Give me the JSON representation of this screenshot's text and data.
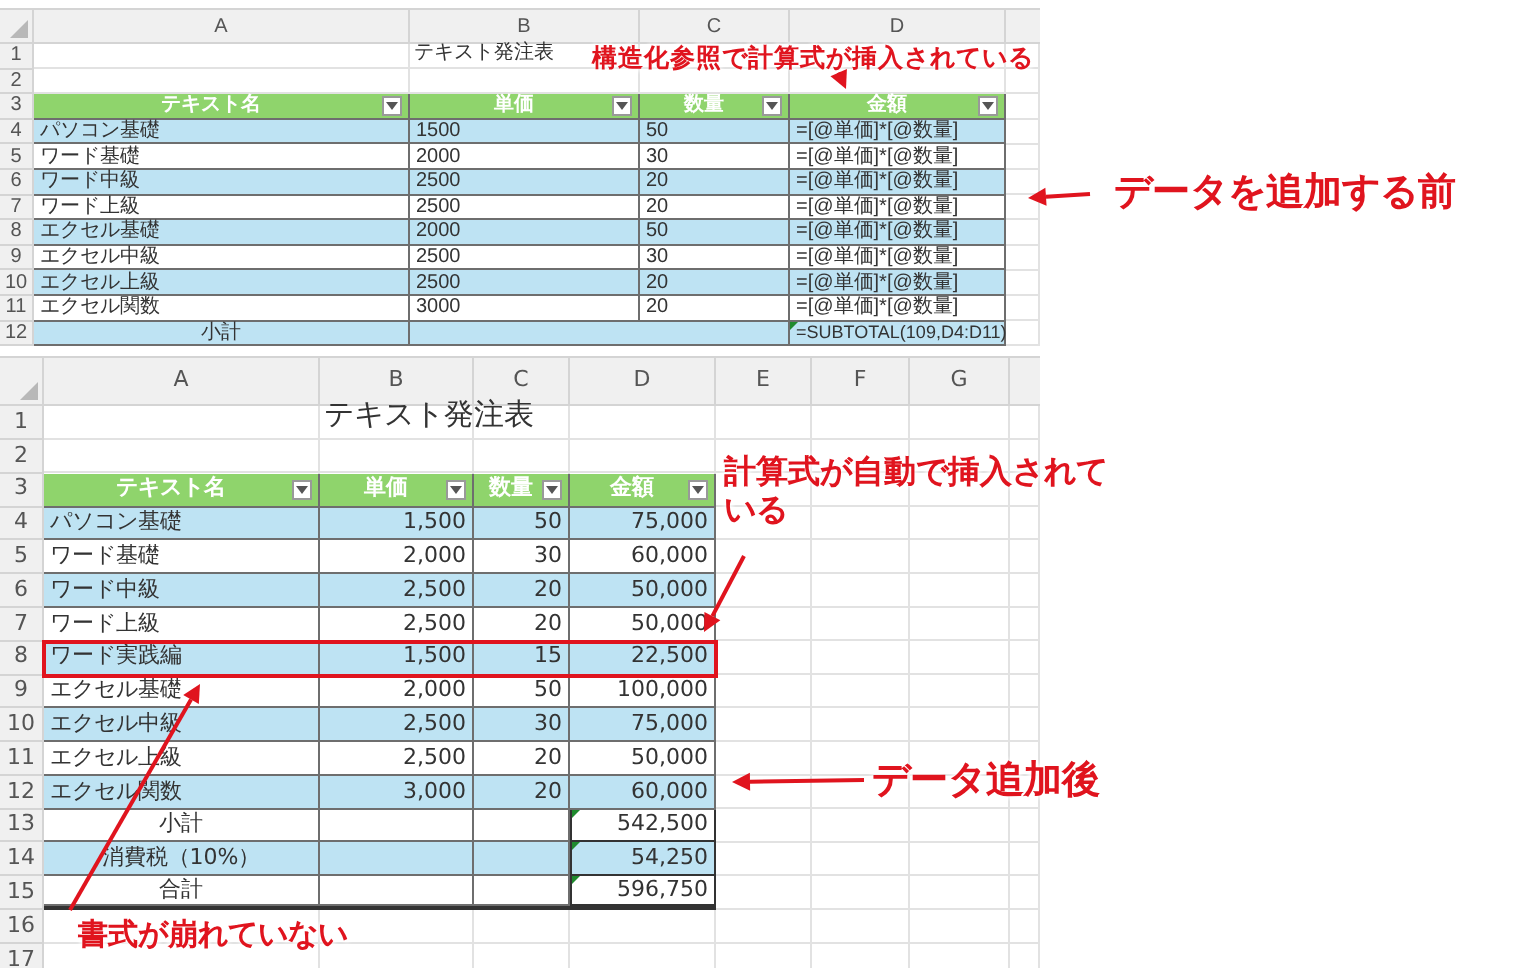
{
  "before_sheet": {
    "kind": "formulas",
    "column_letters": [
      "A",
      "B",
      "C",
      "D"
    ],
    "row_numbers": [
      "1",
      "2",
      "3",
      "4",
      "5",
      "6",
      "7",
      "8",
      "9",
      "10",
      "11",
      "12"
    ],
    "title": "テキスト発注表",
    "headers": [
      "テキスト名",
      "単価",
      "数量",
      "金額"
    ],
    "rows": [
      {
        "cells": [
          "パソコン基礎",
          "1500",
          "50",
          "=[@単価]*[@数量]"
        ],
        "banded": true
      },
      {
        "cells": [
          "ワード基礎",
          "2000",
          "30",
          "=[@単価]*[@数量]"
        ],
        "banded": false
      },
      {
        "cells": [
          "ワード中級",
          "2500",
          "20",
          "=[@単価]*[@数量]"
        ],
        "banded": true
      },
      {
        "cells": [
          "ワード上級",
          "2500",
          "20",
          "=[@単価]*[@数量]"
        ],
        "banded": false
      },
      {
        "cells": [
          "エクセル基礎",
          "2000",
          "50",
          "=[@単価]*[@数量]"
        ],
        "banded": true
      },
      {
        "cells": [
          "エクセル中級",
          "2500",
          "30",
          "=[@単価]*[@数量]"
        ],
        "banded": false
      },
      {
        "cells": [
          "エクセル上級",
          "2500",
          "20",
          "=[@単価]*[@数量]"
        ],
        "banded": true
      },
      {
        "cells": [
          "エクセル関数",
          "3000",
          "20",
          "=[@単価]*[@数量]"
        ],
        "banded": false
      }
    ],
    "totals": [
      {
        "label": "小計",
        "value": "=SUBTOTAL(109,D4:D11)",
        "banded": true
      }
    ]
  },
  "after_sheet": {
    "kind": "values",
    "column_letters": [
      "A",
      "B",
      "C",
      "D",
      "E",
      "F",
      "G"
    ],
    "row_numbers": [
      "1",
      "2",
      "3",
      "4",
      "5",
      "6",
      "7",
      "8",
      "9",
      "10",
      "11",
      "12",
      "13",
      "14",
      "15",
      "16",
      "17"
    ],
    "title": "テキスト発注表",
    "headers": [
      "テキスト名",
      "単価",
      "数量",
      "金額"
    ],
    "rows": [
      {
        "cells": [
          "パソコン基礎",
          "1,500",
          "50",
          "75,000"
        ],
        "banded": true,
        "highlighted": false
      },
      {
        "cells": [
          "ワード基礎",
          "2,000",
          "30",
          "60,000"
        ],
        "banded": false,
        "highlighted": false
      },
      {
        "cells": [
          "ワード中級",
          "2,500",
          "20",
          "50,000"
        ],
        "banded": true,
        "highlighted": false
      },
      {
        "cells": [
          "ワード上級",
          "2,500",
          "20",
          "50,000"
        ],
        "banded": false,
        "highlighted": false
      },
      {
        "cells": [
          "ワード実践編",
          "1,500",
          "15",
          "22,500"
        ],
        "banded": true,
        "highlighted": true
      },
      {
        "cells": [
          "エクセル基礎",
          "2,000",
          "50",
          "100,000"
        ],
        "banded": false,
        "highlighted": false
      },
      {
        "cells": [
          "エクセル中級",
          "2,500",
          "30",
          "75,000"
        ],
        "banded": true,
        "highlighted": false
      },
      {
        "cells": [
          "エクセル上級",
          "2,500",
          "20",
          "50,000"
        ],
        "banded": false,
        "highlighted": false
      },
      {
        "cells": [
          "エクセル関数",
          "3,000",
          "20",
          "60,000"
        ],
        "banded": true,
        "highlighted": false
      }
    ],
    "totals": [
      {
        "label": "小計",
        "value": "542,500",
        "banded": false
      },
      {
        "label": "消費税（10%）",
        "value": "54,250",
        "banded": true
      },
      {
        "label": "合計",
        "value": "596,750",
        "banded": false
      }
    ]
  },
  "annotations": [
    {
      "text": "構造化参照で計算式が挿入されている"
    },
    {
      "text": "データを追加する前"
    },
    {
      "text": "計算式が自動で挿入されている"
    },
    {
      "text": "データ追加後"
    },
    {
      "text": "書式が崩れていない"
    }
  ]
}
